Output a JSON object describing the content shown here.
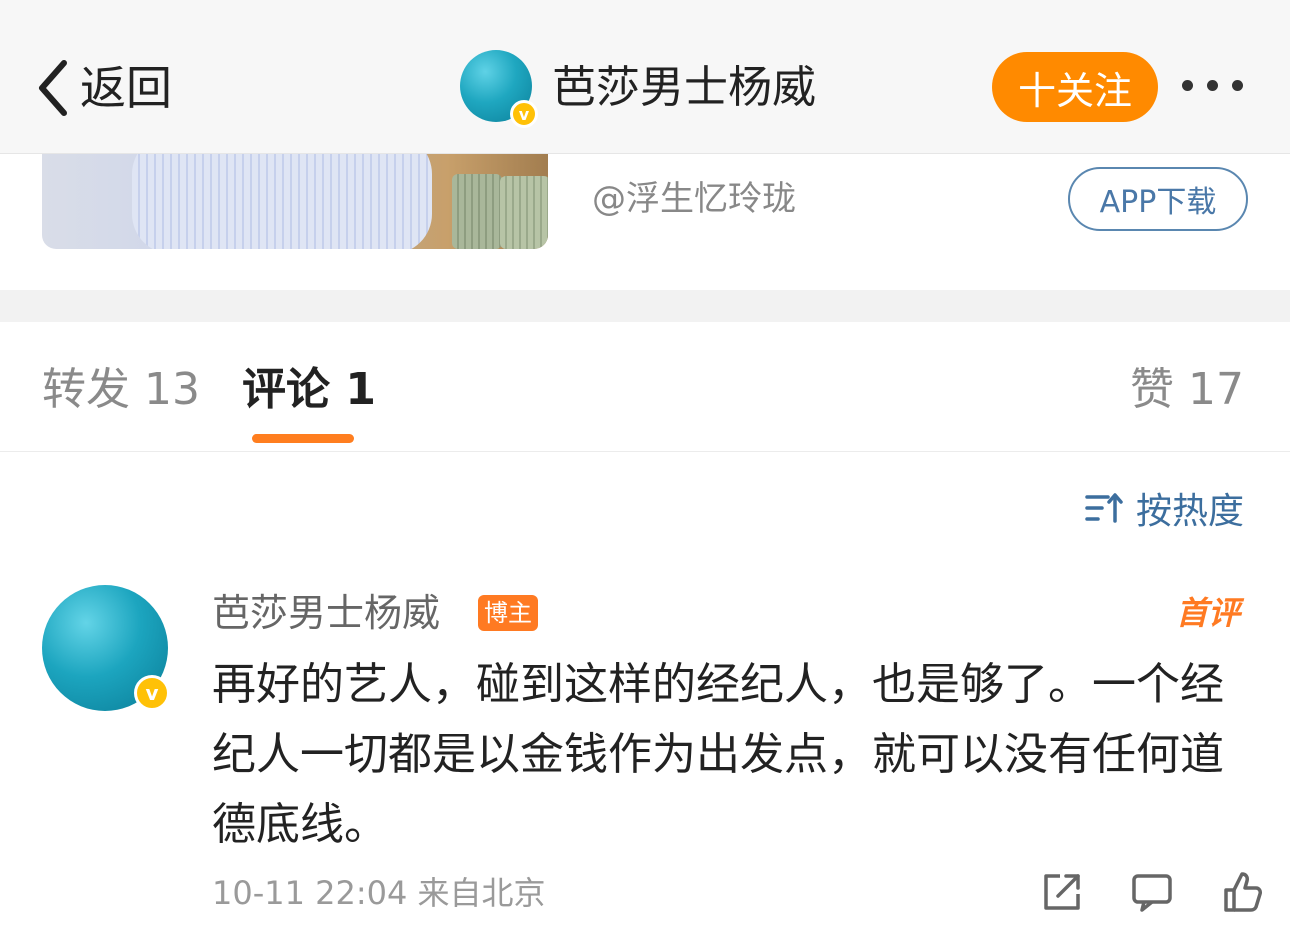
{
  "header": {
    "back_label": "返回",
    "title": "芭莎男士杨威",
    "follow_label": "十关注",
    "verified_mark": "v"
  },
  "card": {
    "source": "@浮生忆玲珑",
    "app_button": "APP下载"
  },
  "tabs": {
    "repost": "转发 13",
    "comment": "评论 1",
    "like": "赞 17"
  },
  "sort": {
    "label": "按热度"
  },
  "comment": {
    "author": "芭莎男士杨威",
    "tag": "博主",
    "first_badge": "首评",
    "text": "再好的艺人，碰到这样的经纪人，也是够了。一个经纪人一切都是以金钱作为出发点，就可以没有任何道德底线。",
    "meta": "10-11 22:04 来自北京"
  },
  "colors": {
    "accent": "#ff8a00",
    "link": "#4a78a8",
    "underline": "#ff7e1f"
  }
}
